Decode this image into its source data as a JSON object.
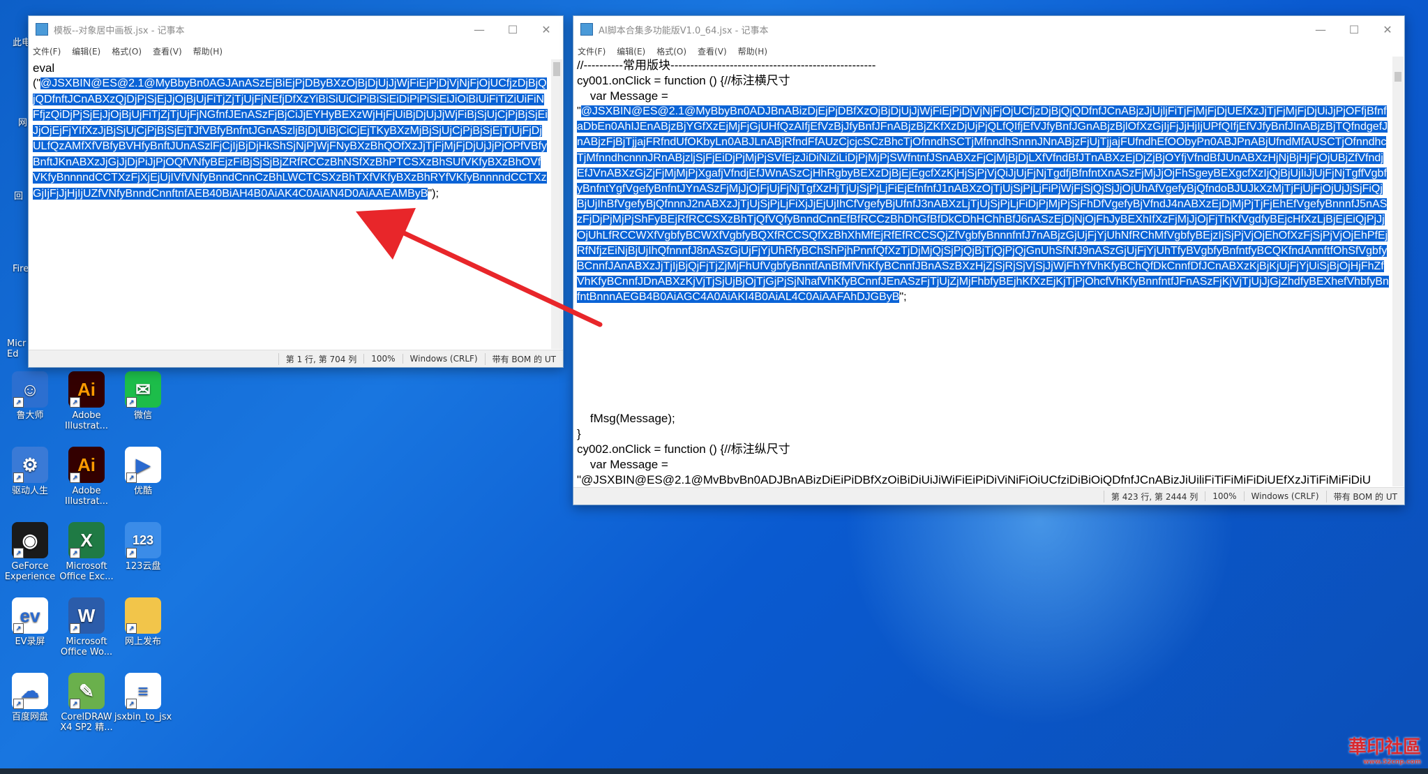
{
  "desktop": {
    "partial_labels": [
      "此电",
      "网",
      "回",
      "Fire",
      "Micr Ed"
    ],
    "icons": [
      {
        "label": "鲁大师",
        "icon": "ludashi-icon",
        "color": "#2c6fd0",
        "glyph": "☺"
      },
      {
        "label": "Adobe Illustrat...",
        "icon": "illustrator-icon",
        "color": "#330000",
        "glyph": "Ai"
      },
      {
        "label": "微信",
        "icon": "wechat-icon",
        "color": "#1dbd4a",
        "glyph": "✉"
      },
      {
        "label": "驱动人生",
        "icon": "driver-life-icon",
        "color": "#3a7ad6",
        "glyph": "⚙"
      },
      {
        "label": "Adobe Illustrat...",
        "icon": "illustrator-icon",
        "color": "#330000",
        "glyph": "Ai"
      },
      {
        "label": "优酷",
        "icon": "youku-icon",
        "color": "#ffffff",
        "glyph": "▶"
      },
      {
        "label": "GeForce Experience",
        "icon": "geforce-icon",
        "color": "#1a1a1a",
        "glyph": "◉"
      },
      {
        "label": "Microsoft Office Exc...",
        "icon": "excel-icon",
        "color": "#1f7a44",
        "glyph": "X"
      },
      {
        "label": "123云盘",
        "icon": "123pan-icon",
        "color": "#3b8ce8",
        "glyph": "123"
      },
      {
        "label": "EV录屏",
        "icon": "ev-recorder-icon",
        "color": "#ffffff",
        "glyph": "ev"
      },
      {
        "label": "Microsoft Office Wo...",
        "icon": "word-icon",
        "color": "#2b5caa",
        "glyph": "W"
      },
      {
        "label": "网上发布",
        "icon": "folder-icon",
        "color": "#f2c54a",
        "glyph": ""
      },
      {
        "label": "百度网盘",
        "icon": "baidu-netdisk-icon",
        "color": "#ffffff",
        "glyph": "☁"
      },
      {
        "label": "CorelDRAW X4 SP2 精...",
        "icon": "coreldraw-icon",
        "color": "#6ab04c",
        "glyph": "✎"
      },
      {
        "label": "jsxbin_to_jsx",
        "icon": "text-file-icon",
        "color": "#ffffff",
        "glyph": "≡"
      }
    ]
  },
  "left_window": {
    "title": "模板--对象居中画板.jsx - 记事本",
    "menu": [
      "文件(F)",
      "编辑(E)",
      "格式(O)",
      "查看(V)",
      "帮助(H)"
    ],
    "line1": "eval",
    "prefix": "(\"",
    "selected": "@JSXBIN@ES@2.1@MyBbyBn0AGJAnASzEjBiEjPjDByBXzOjBjDjUjJjWjFiEjPjDjVjNjFjOjUCfjzDjBjQjQDfnftJCnABXzQjDjPjSjEjJjOjBjUjFiTjZjTjUjFjNEfjDfXzYiBiSiUiCiPiBiSiEiDiPiPiSiEiJiOiBiUiFiTiZiUiFiNFfjzQiDjPjSjEjJjOjBjUjFiTjZjTjUjFjNGfnfJEnASzFjBjCiJjEYHyBEXzWjHjFjUiBjDjUjJjWjFiBjSjUjCjPjBjSjEiJjOjEjFjYIfXzJjBjSjUjCjPjBjSjEjTJfVBfyBnfntJGnASzljBjDjUiBjCiCjEjTKyBXzMjBjSjUjCjPjBjSjEjTjUjFjDjULfQzAMfXfVBfyBVHfyBnftJUnASzlFjCjIjBjDjHkShSjNjPjWjFNyBXzBhQOfXzJjTjFjMjFjDjUjJjPjOPfVBfyBnftJKnABXzJjGjJjDjPiJjPjOQfVNfyBEjzFiBjSjSjBjZRfRCCzBhNSfXzBhPTCSXzBhSUfVKfyBXzBhOVfVKfyBnnnndCCTXzFjXjEjUjIVfVNfyBnndCnnCzBhLWCTCSXzBhTXfVKfyBXzBhRYfVKfyBnnnndCCTXzGjIjFjJjHjIjUZfVNfyBnndCnnftnfAEB40BiAH4B0AiAK4C0AiAN4D0AiAAEAMByB",
    "suffix": "\");",
    "status": [
      "第 1 行, 第 704 列",
      "100%",
      "Windows (CRLF)",
      "带有 BOM 的 UT"
    ]
  },
  "right_window": {
    "title": "AI脚本合集多功能版V1.0_64.jsx - 记事本",
    "menu": [
      "文件(F)",
      "编辑(E)",
      "格式(O)",
      "查看(V)",
      "帮助(H)"
    ],
    "line1": "//----------常用版块----------------------------------------------------",
    "line2": "cy001.onClick = function () {//标注横尺寸",
    "line3": "    var Message =",
    "prefix": "\"",
    "selected": "@JSXBIN@ES@2.1@MyBbyBn0ADJBnABizDjEjPjDBfXzOjBjDjUjJjWjFiEjPjDjVjNjFjOjUCfjzDjBjQjQDfnfJCnABjzJjUjljFiTjFjMjFjDjUEfXzJjTjFjMjFjDjUiJjPjOFfjBfnfaDbEn0AhIJEnABjzBjYGfXzEjMjFjGjUHfQzAIfjEfVzBjJfyBnfJFnABjzBjZKfXzDjUjPjQLfQIfjEfVJfyBnfJGnABjzBjlOfXzGjIjFjJjHjIjUPfQIfjEfVJfyBnfJInABjzBjTQfndgefJnABjzFjBjTjjajFRfndUfOKbyLn0ABJLnABjRfndFfAUzCjcjcSCzBhcTjOfnndhSCTjMfnndhSnnnJNnABjzFjUjTjjajFUfndhEfOObyPn0ABJPnABjUfndMfAUSCTjOfnndhcTjMfnndhcnnnJRnABjzljSjFjEiDjPjMjPjSVfEjzJiDiNiZiLiDjPjMjPjSWfntnfJSnABXzFjCjMjBjDjLXfVfndBfJTnABXzEjDjZjBjOYfjVfndBfJUnABXzHjNjBjHjFjOjUBjZfVfndjEfJVnABXzGjZjFjMjMjPjXgafjVfndjEfJWnASzCjHhRgbyBEXzDjBjEjEgcfXzKjHjSjPjVjQiJjUjFjNjTgdfjBfnfntXnASzFjMjJjOjFhSgeyBEXgcfXzIjQjBjUjIiJjUjFjNjTgffVgbfyBnfntYgfVgefyBnfntJYnASzFjMjJjOjFjUjFjNjTgfXzHjTjUjSjPjLjFiEjEfnfnfJ1nABXzOjTjUjSjPjLjFiPjWjFjSjQjSjJjOjUhAfVgefyBjQfndoBJUJkXzMjTjFjUjFjOjUjJjSjFiQjBjUjIhBfVgefyBjQfnnnJ2nABXzJjTjUjSjPjLjFiXjJjEjUjIhCfVgefyBjUfnfJ3nABXzLjTjUjSjPjLjFiDjPjMjPjSjFhDfVgefyBjVfndJ4nABXzEjDjMjPjTjFjEhEfVgefyBnnnfJ5nASzFjDjPjMjPjShFyBEjRfRCCSXzBhTjQfVQfyBnndCnnEfBfRCCzBhDhGfBfDkCDhHChhBfJ6nASzEjDjNjOjFhJyBEXhIfXzFjMjJjOjFjThKfVgdfyBEjcHfXzLjBjEjEiQjPjJjOjUhLfRCCWXfVgbfyBCWXfVgbfyBQXfRCCSQfXzBhXhMfEjRfEfRCCSQjZfVgbfyBnnnfnfJ7nABjzGjUjFjYjUhNfRChMfVgbfyBEjzIjSjPjVjOjEhOfXzFjSjPjVjOjEhPfEjRfNfjzEiNjBjUjIhQfnnnfJ8nASzGjUjFjYjUhRfyBChShPjhPnnfQfXzTjDjMjQjSjPjQjBjTjQjPjQjGnUhSfNfJ9nASzGjUjFjYjUhTfyBVgbfyBnfntfyBCQKfndAnnftfOhSfVgbfyBCnnfJAnABXzJjTjIjBjQjFjTjZjMjFhUfVgbfyBnntfAnBfMfVhKfyBCnnfJBnASzBXzHjZjSjRjSjVjSjJjWjFhYfVhKfyBChQfDkCnnfDfJCnABXzKjBjKjUjFjYjUiSjBjOjHjFhZfVhKfyBCnnfJDnABXzKjVjTjSjUjBjOjTjGjPjSjNhafVhKfyBCnnfJEnASzFjTjUjZjMjFhbfyBEjhKfXzEjKjTjPjOhcfVhKfyBnnfntfJFnASzFjKjVjTjUjJjGjZhdfyBEXhefVhbfyBnfntBnnnAEGB4B0AiAGC4A0AiAKI4B0AiAL4C0AiAAFAhDJGByB",
    "suffix": "\";",
    "line_after1": "    fMsg(Message);",
    "line_after2": "}",
    "line_after3": "cy002.onClick = function () {//标注纵尺寸",
    "line_after4": "    var Message =",
    "line_after5": "\"@JSXBIN@ES@2.1@MvBbvBn0ADJBnABizDiEiPiDBfXzOiBiDiUiJiWiFiEiPiDiViNiFiOiUCfziDiBiOiQDfnfJCnABizJiUiliFiTiFiMiFiDiUEfXzJiTiFiMiFiDiU",
    "status": [
      "第 423 行, 第 2444 列",
      "100%",
      "Windows (CRLF)",
      "带有 BOM 的 UT"
    ]
  },
  "watermark": {
    "text": "華印社區",
    "sub": "www.52cnp.com"
  },
  "annotation": {
    "arrow_color": "#e8262a"
  }
}
